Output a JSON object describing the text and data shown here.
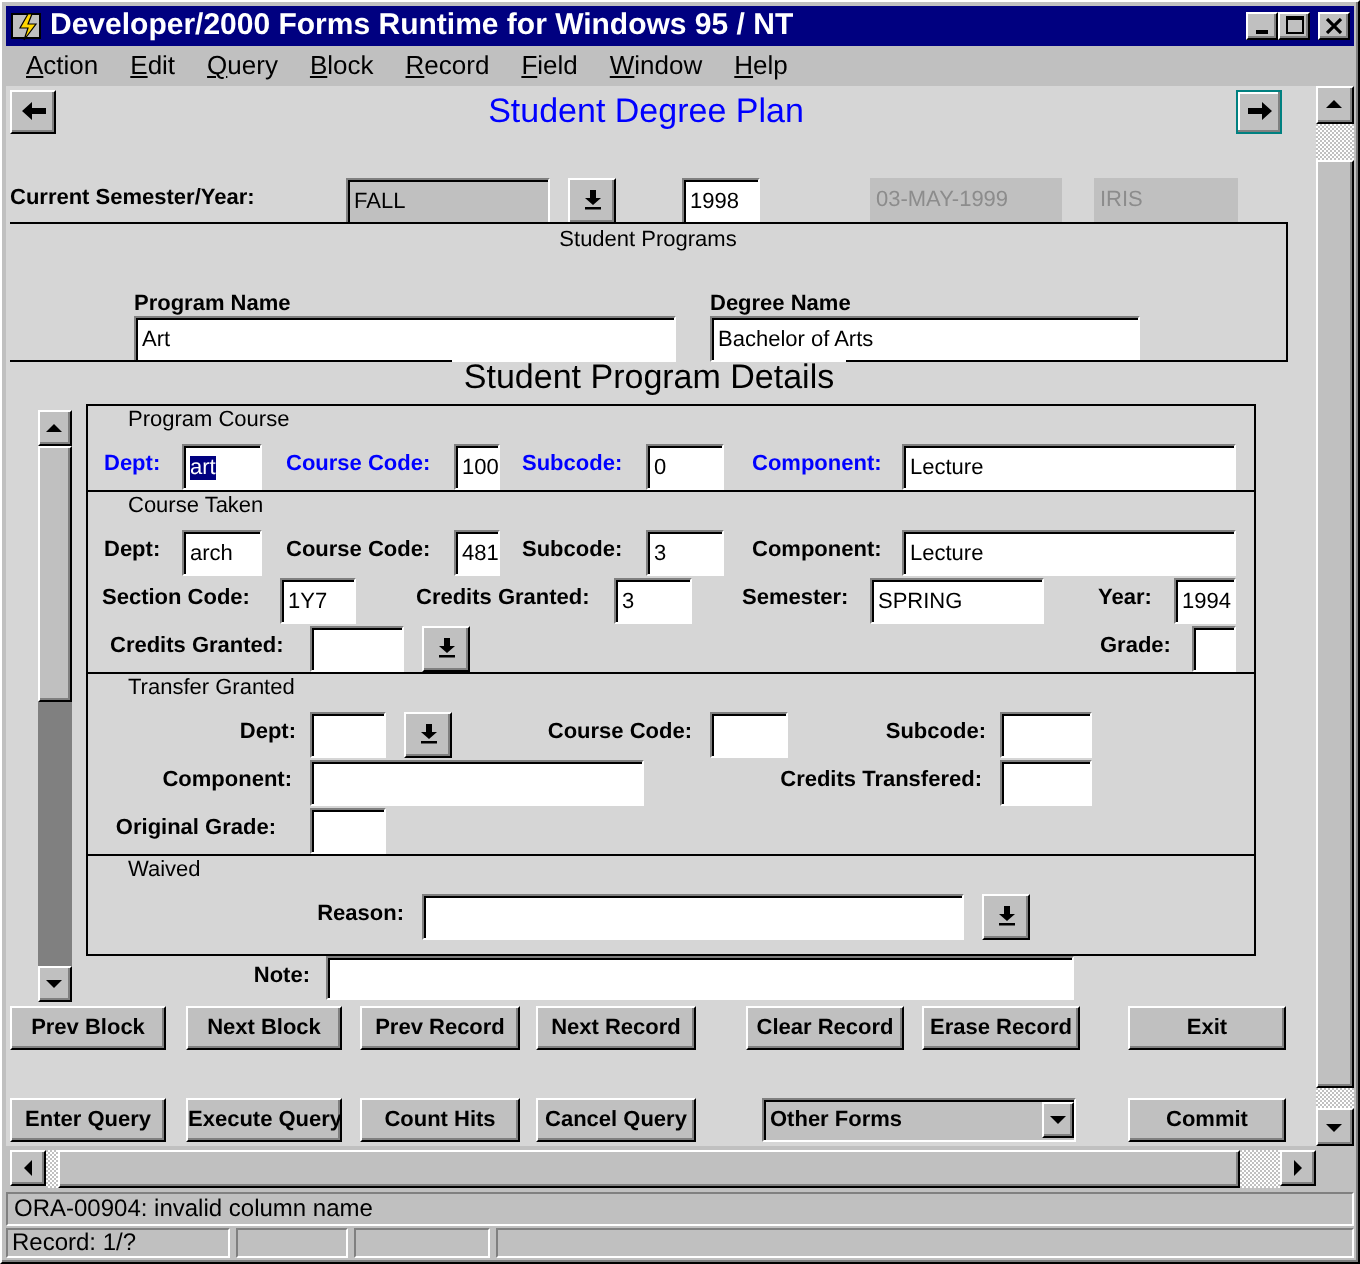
{
  "window": {
    "title": "Developer/2000 Forms Runtime for Windows 95 / NT"
  },
  "menu": [
    "Action",
    "Edit",
    "Query",
    "Block",
    "Record",
    "Field",
    "Window",
    "Help"
  ],
  "form": {
    "title": "Student Degree Plan"
  },
  "current_term": {
    "label": "Current Semester/Year:",
    "fields": [
      {
        "kind": "list",
        "value": "FALL",
        "disabled": false
      },
      {
        "kind": "text",
        "value": "1998",
        "disabled": false
      },
      {
        "kind": "text",
        "value": "03-MAY-1999",
        "disabled": true
      },
      {
        "kind": "text",
        "value": "IRIS",
        "disabled": true
      }
    ]
  },
  "student_programs": {
    "legend": "Student Programs",
    "fields": [
      {
        "label": "Program Name",
        "value": "Art"
      },
      {
        "label": "Degree Name",
        "value": "Bachelor of Arts"
      }
    ]
  },
  "details": {
    "title": "Student Program Details",
    "sections": [
      {
        "legend": "Program Course",
        "emphasis": true,
        "fields": [
          {
            "label": "Dept:",
            "kind": "text",
            "value": "art",
            "focused": true
          },
          {
            "label": "Course Code:",
            "kind": "text",
            "value": "100",
            "focused": false
          },
          {
            "label": "Subcode:",
            "kind": "text",
            "value": "0",
            "focused": false
          },
          {
            "label": "Component:",
            "kind": "text",
            "value": "Lecture",
            "focused": false
          }
        ]
      },
      {
        "legend": "Course Taken",
        "emphasis": false,
        "fields": [
          {
            "label": "Dept:",
            "kind": "text",
            "value": "arch"
          },
          {
            "label": "Course Code:",
            "kind": "text",
            "value": "481"
          },
          {
            "label": "Subcode:",
            "kind": "text",
            "value": "3"
          },
          {
            "label": "Component:",
            "kind": "text",
            "value": "Lecture"
          },
          {
            "label": "Section Code:",
            "kind": "text",
            "value": "1Y7"
          },
          {
            "label": "Credits Granted:",
            "kind": "text",
            "value": "3"
          },
          {
            "label": "Semester:",
            "kind": "text",
            "value": "SPRING"
          },
          {
            "label": "Year:",
            "kind": "text",
            "value": "1994"
          },
          {
            "label": "Credits Granted:",
            "kind": "list"
          },
          {
            "label": "Grade:",
            "kind": "text"
          }
        ]
      },
      {
        "legend": "Transfer Granted",
        "emphasis": false,
        "fields": [
          {
            "label": "Dept:",
            "kind": "list"
          },
          {
            "label": "Course Code:",
            "kind": "text"
          },
          {
            "label": "Subcode:",
            "kind": "text"
          },
          {
            "label": "Component:",
            "kind": "text"
          },
          {
            "label": "Credits Transfered:",
            "kind": "text"
          },
          {
            "label": "Original Grade:",
            "kind": "text"
          }
        ]
      },
      {
        "legend": "Waived",
        "emphasis": false,
        "fields": [
          {
            "label": "Reason:",
            "kind": "list"
          }
        ]
      }
    ]
  },
  "note": {
    "label": "Note:"
  },
  "button_rows": [
    [
      {
        "kind": "button",
        "label": "Prev Block"
      },
      {
        "kind": "button",
        "label": "Next Block"
      },
      {
        "kind": "button",
        "label": "Prev Record"
      },
      {
        "kind": "button",
        "label": "Next Record"
      },
      {
        "kind": "button",
        "label": "Clear Record"
      },
      {
        "kind": "button",
        "label": "Erase Record"
      },
      {
        "kind": "button",
        "label": "Exit"
      }
    ],
    [
      {
        "kind": "button",
        "label": "Enter Query"
      },
      {
        "kind": "button",
        "label": "Execute Query"
      },
      {
        "kind": "button",
        "label": "Count Hits"
      },
      {
        "kind": "button",
        "label": "Cancel Query"
      },
      {
        "kind": "list",
        "label": "Other Forms"
      },
      {
        "kind": "button",
        "label": "Commit"
      }
    ]
  ],
  "status_bar": {
    "message": "ORA-00904: invalid column name",
    "record": "Record: 1/?"
  }
}
